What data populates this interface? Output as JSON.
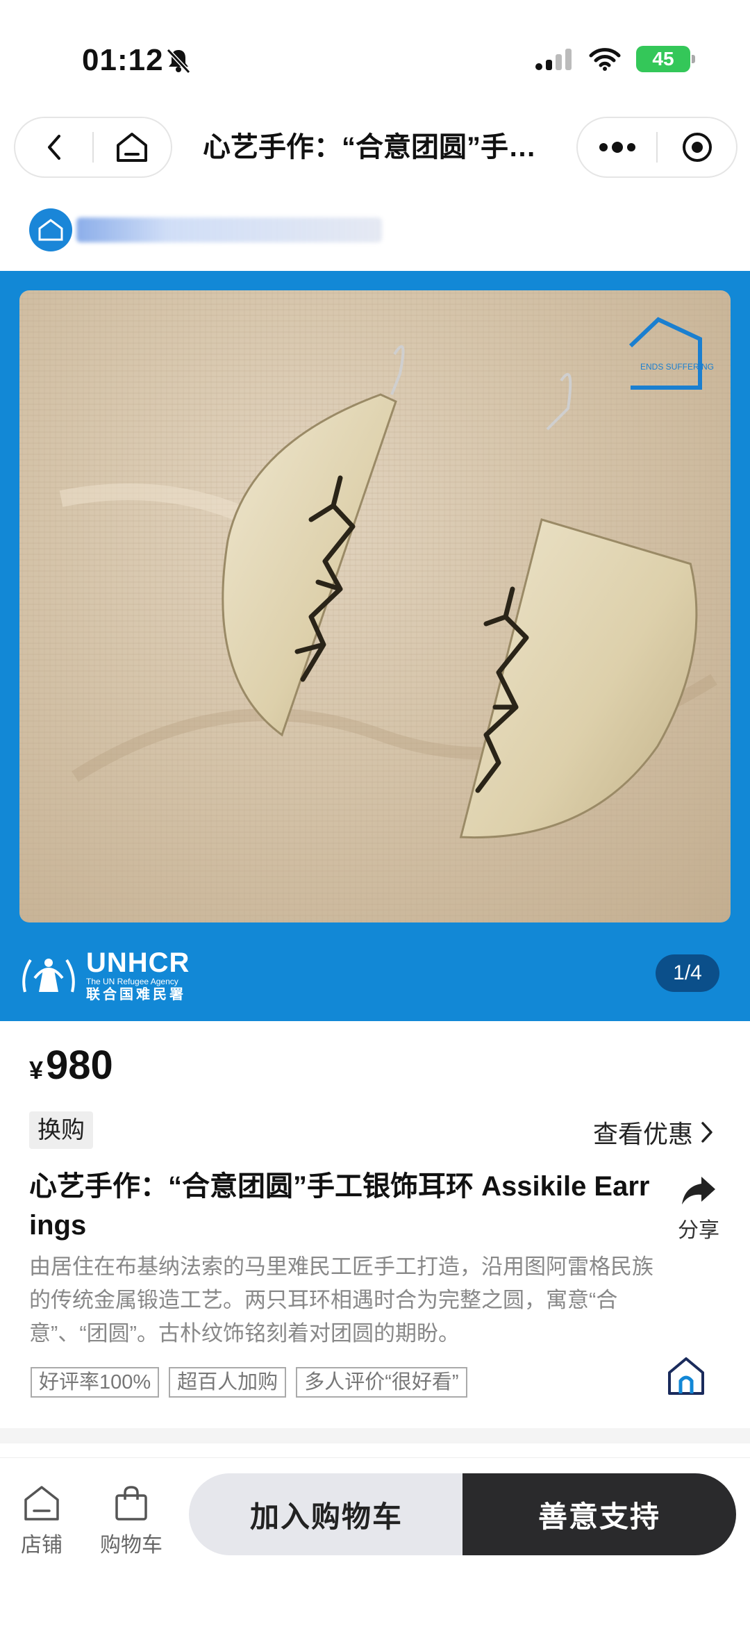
{
  "status_bar": {
    "time": "01:12",
    "battery": "45"
  },
  "nav": {
    "title": "心艺手作：“合意团圆”手工银饰耳环 Assikile Earrings"
  },
  "gallery": {
    "logo_main": "UNHCR",
    "logo_sub": "The UN Refugee Agency",
    "logo_cn": "联合国难民署",
    "watermark_text": "ENDS SUFFERING",
    "page_indicator": "1/4"
  },
  "product": {
    "currency": "¥",
    "price": "980",
    "tag": "换购",
    "view_discount": "查看优惠",
    "title": "心艺手作：“合意团圆”手工银饰耳环 Assikile Earrings",
    "share_label": "分享",
    "description": "由居住在布基纳法索的马里难民工匠手工打造，沿用图阿雷格民族的传统金属锻造工艺。两只耳环相遇时合为完整之圆，寓意“合意”、“团圆”。古朴纹饰铭刻着对团圆的期盼。",
    "labels": [
      "好评率100%",
      "超百人加购",
      "多人评价“很好看”"
    ]
  },
  "bottom_bar": {
    "store_label": "店铺",
    "cart_label": "购物车",
    "add_to_cart": "加入购物车",
    "support": "善意支持"
  },
  "colors": {
    "gallery_bg": "#1288d6",
    "support_btn": "#2a2a2c",
    "battery": "#34c759"
  }
}
